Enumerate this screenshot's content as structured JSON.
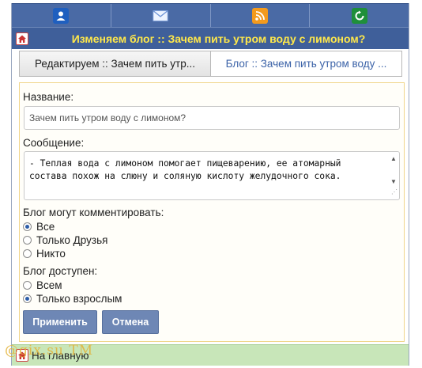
{
  "nav": {
    "icons": [
      "user-icon",
      "mail-icon",
      "rss-icon",
      "refresh-icon"
    ]
  },
  "header": {
    "title": "Изменяем блог :: Зачем пить утром воду с лимоном?"
  },
  "tabs": [
    {
      "label": "Редактируем :: Зачем пить утр...",
      "active": true
    },
    {
      "label": "Блог :: Зачем пить утром воду ...",
      "active": false
    }
  ],
  "form": {
    "name_label": "Название:",
    "name_value": "Зачем пить утром воду с лимоном?",
    "message_label": "Сообщение:",
    "message_value": "- Теплая вода с лимоном помогает пищеварению, ее атомарный состава похож на слюну и соляную кислоту желудочного сока.",
    "comment_label": "Блог могут комментировать:",
    "comment_options": [
      {
        "label": "Все",
        "checked": true
      },
      {
        "label": "Только Друзья",
        "checked": false
      },
      {
        "label": "Никто",
        "checked": false
      }
    ],
    "access_label": "Блог доступен:",
    "access_options": [
      {
        "label": "Всем",
        "checked": false
      },
      {
        "label": "Только взрослым",
        "checked": true
      }
    ],
    "apply_button": "Применить",
    "cancel_button": "Отмена"
  },
  "footer": {
    "home_link": "На главную",
    "watermark": "@gix.su TM"
  },
  "colors": {
    "header_bg": "#3f5f9a",
    "title_text": "#ffe84a",
    "button_bg": "#6e87b5",
    "footer_bg": "#c8e6b9"
  }
}
